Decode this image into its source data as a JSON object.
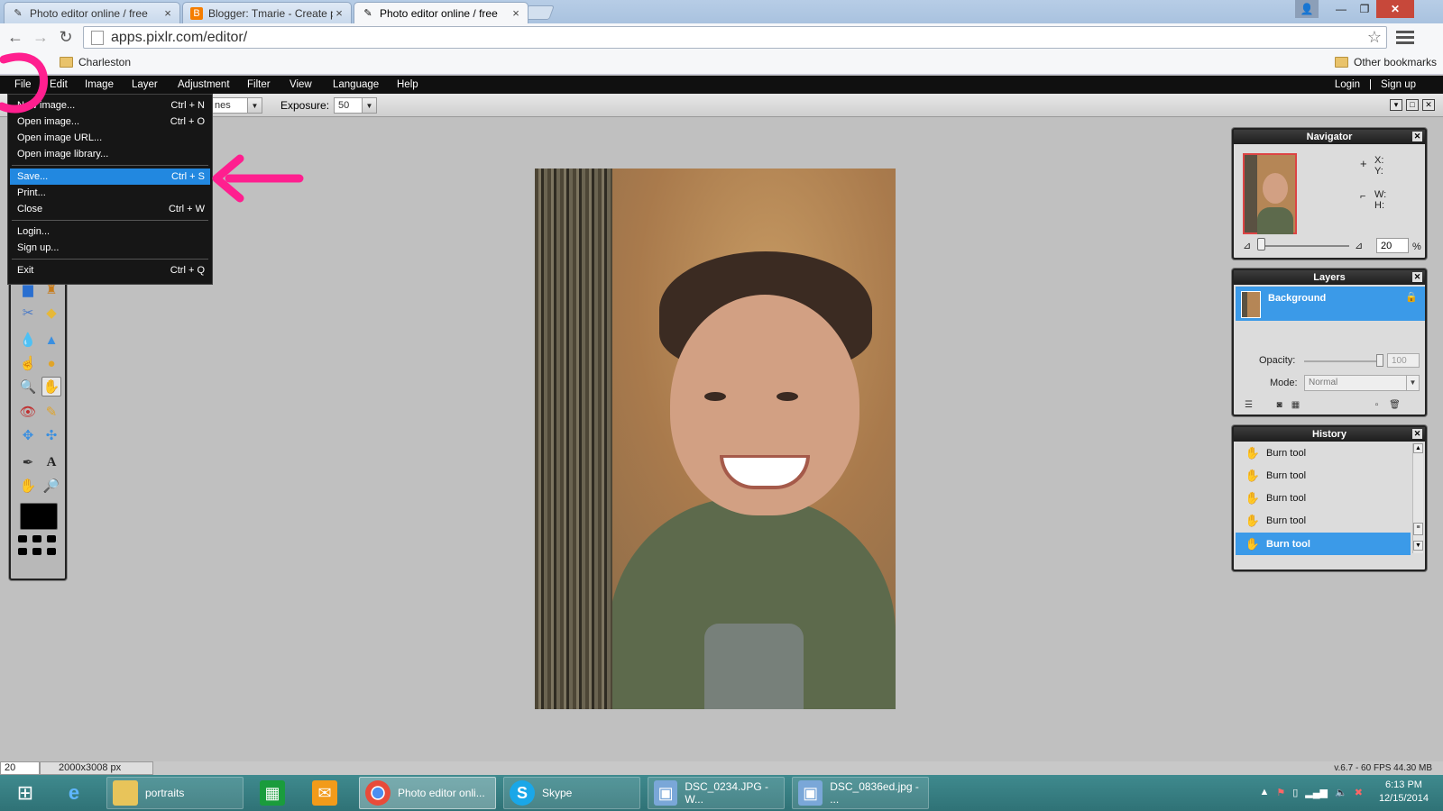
{
  "browser": {
    "tabs": [
      {
        "title": "Photo editor online / free",
        "active": false,
        "icon": "brush-icon"
      },
      {
        "title": "Blogger: Tmarie - Create p",
        "active": false,
        "icon": "blogger-icon"
      },
      {
        "title": "Photo editor online / free",
        "active": true,
        "icon": "brush-icon"
      }
    ],
    "url": "apps.pixlr.com/editor/",
    "bookmarks": {
      "folder1": "Charleston",
      "other": "Other bookmarks"
    }
  },
  "menubar": {
    "items": [
      "File",
      "Edit",
      "Image",
      "Layer",
      "Adjustment",
      "Filter",
      "View",
      "Language",
      "Help"
    ],
    "login": "Login",
    "separator": "|",
    "signup": "Sign up"
  },
  "options": {
    "range_partial": "nes",
    "exposure_label": "Exposure:",
    "exposure_value": "50"
  },
  "file_menu": {
    "items": [
      {
        "label": "New image...",
        "shortcut": "Ctrl + N"
      },
      {
        "label": "Open image...",
        "shortcut": "Ctrl + O"
      },
      {
        "label": "Open image URL...",
        "shortcut": ""
      },
      {
        "label": "Open image library...",
        "shortcut": ""
      },
      {
        "label": "Save...",
        "shortcut": "Ctrl + S",
        "highlighted": true
      },
      {
        "label": "Print...",
        "shortcut": ""
      },
      {
        "label": "Close",
        "shortcut": "Ctrl + W"
      },
      {
        "label": "Login...",
        "shortcut": ""
      },
      {
        "label": "Sign up...",
        "shortcut": ""
      },
      {
        "label": "Exit",
        "shortcut": "Ctrl + Q"
      }
    ]
  },
  "navigator": {
    "title": "Navigator",
    "x_label": "X:",
    "y_label": "Y:",
    "w_label": "W:",
    "h_label": "H:",
    "zoom": "20",
    "zoom_unit": "%"
  },
  "layers": {
    "title": "Layers",
    "layer_name": "Background",
    "opacity_label": "Opacity:",
    "opacity_value": "100",
    "mode_label": "Mode:",
    "mode_value": "Normal"
  },
  "history": {
    "title": "History",
    "items": [
      "Burn tool",
      "Burn tool",
      "Burn tool",
      "Burn tool",
      "Burn tool"
    ],
    "selected_index": 4
  },
  "status": {
    "zoom": "20",
    "zoom_unit": "%",
    "dimensions": "2000x3008 px",
    "version": "v.6.7 - 60 FPS 44.30 MB"
  },
  "taskbar": {
    "items": [
      "portraits",
      "Photo editor onli...",
      "Skype",
      "DSC_0234.JPG - W...",
      "DSC_0836ed.jpg - ..."
    ],
    "time": "6:13 PM",
    "date": "12/15/2014"
  },
  "colors": {
    "highlight": "#2288e0",
    "annotation": "#ff1f8f",
    "taskbar": "#2f7276"
  }
}
